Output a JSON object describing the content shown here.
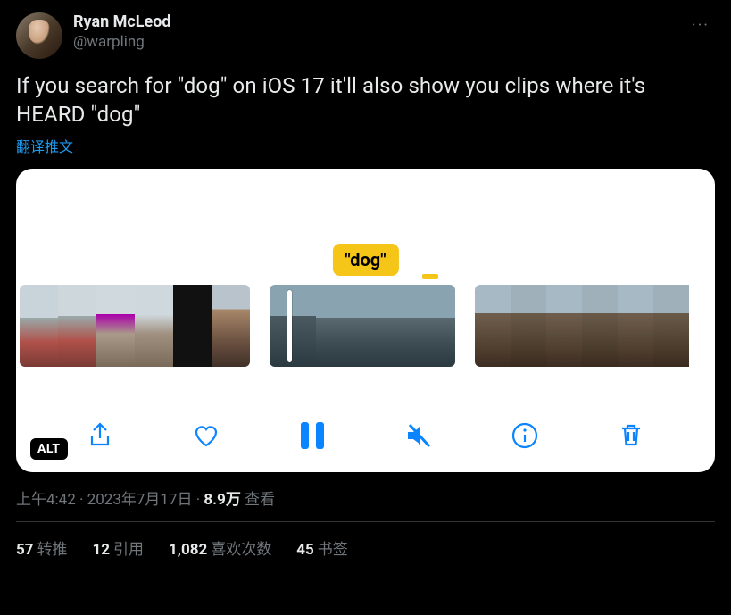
{
  "author": {
    "display_name": "Ryan McLeod",
    "handle": "@warpling"
  },
  "more_icon_glyph": "···",
  "body": "If you search for \"dog\" on iOS 17 it'll also show you clips where it's HEARD \"dog\"",
  "translate_label": "翻译推文",
  "media": {
    "caption_text": "\"dog\"",
    "alt_badge": "ALT",
    "toolbar_icons": {
      "share": "share-icon",
      "like": "heart-icon",
      "pause": "pause-icon",
      "mute": "speaker-muted-icon",
      "info": "info-icon",
      "delete": "trash-icon"
    }
  },
  "meta": {
    "time": "上午4:42",
    "dot1": " · ",
    "date": "2023年7月17日",
    "dot2": " · ",
    "views_number": "8.9万",
    "views_label": " 查看"
  },
  "stats": {
    "retweets_num": "57",
    "retweets_label": "转推",
    "quotes_num": "12",
    "quotes_label": "引用",
    "likes_num": "1,082",
    "likes_label": "喜欢次数",
    "bookmarks_num": "45",
    "bookmarks_label": "书签"
  }
}
